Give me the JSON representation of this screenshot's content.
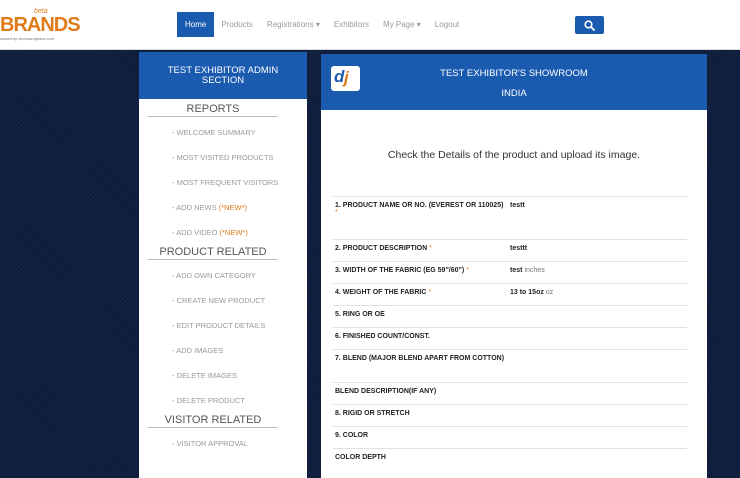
{
  "header": {
    "logo": {
      "beta": "beta",
      "brand": "BRANDS",
      "tagline": "owned by denimandjeans.com"
    },
    "nav": [
      {
        "label": "Home",
        "active": true
      },
      {
        "label": "Products",
        "active": false
      },
      {
        "label": "Registrations ▾",
        "active": false
      },
      {
        "label": "Exhibitors",
        "active": false
      },
      {
        "label": "My Page ▾",
        "active": false
      },
      {
        "label": "Logout",
        "active": false
      }
    ]
  },
  "sidebar": {
    "title_line1": "TEST EXHIBITOR ADMIN",
    "title_line2": "SECTION",
    "reports_heading": "REPORTS",
    "reports": [
      {
        "label": "- WELCOME SUMMARY",
        "new": ""
      },
      {
        "label": "- MOST VISITED PRODUCTS",
        "new": ""
      },
      {
        "label": "- MOST FREQUENT VISITORS",
        "new": ""
      },
      {
        "label": "- ADD NEWS ",
        "new": "(*NEW*)"
      },
      {
        "label": "- ADD VIDEO ",
        "new": "(*NEW*)"
      }
    ],
    "product_heading": "PRODUCT RELATED",
    "product_links": [
      "- ADD OWN CATEGORY",
      "- CREATE NEW PRODUCT",
      "- EDIT PRODUCT DETAILS",
      "- ADD IMAGES",
      "- DELETE IMAGES",
      "- DELETE PRODUCT"
    ],
    "visitor_heading": "VISITOR RELATED",
    "visitor_links": [
      "- VISITOR APPROVAL"
    ]
  },
  "main": {
    "logo": {
      "d": "d",
      "j": "j"
    },
    "title_line1": "TEST EXHIBITOR'S SHOWROOM",
    "title_line2": "INDIA",
    "instruction": "Check the Details of the product and upload its image.",
    "rows": [
      {
        "label": "1. PRODUCT NAME OR NO. (EVEREST OR 110025)",
        "required": "*",
        "required_newline": true,
        "value": "testt",
        "unit": ""
      },
      {
        "label": "2. PRODUCT DESCRIPTION ",
        "required": "*",
        "value": "testtt",
        "unit": ""
      },
      {
        "label": "3. WIDTH OF THE FABRIC (EG 59\"/60\") ",
        "required": "*",
        "value": "test",
        "unit": "inches"
      },
      {
        "label": "4. WEIGHT OF THE FABRIC ",
        "required": "*",
        "value": "13 to 15oz",
        "unit": "oz"
      },
      {
        "label": "5. RING OR OE",
        "required": "",
        "value": "",
        "unit": ""
      },
      {
        "label": "6. FINISHED COUNT/CONST.",
        "required": "",
        "value": "",
        "unit": ""
      },
      {
        "label": "7. BLEND (MAJOR BLEND APART FROM COTTON)",
        "required": "",
        "value": "",
        "unit": ""
      },
      {
        "label": "BLEND DESCRIPTION(IF ANY)",
        "required": "",
        "value": "",
        "unit": ""
      },
      {
        "label": "8. RIGID OR STRETCH",
        "required": "",
        "value": "",
        "unit": ""
      },
      {
        "label": "9. COLOR",
        "required": "",
        "value": "",
        "unit": ""
      },
      {
        "label": "COLOR DEPTH",
        "required": "",
        "value": "",
        "unit": ""
      }
    ]
  },
  "colors": {
    "primary": "#1a5bb0",
    "accent": "#e07b1a",
    "background": "#0f1e3f"
  }
}
